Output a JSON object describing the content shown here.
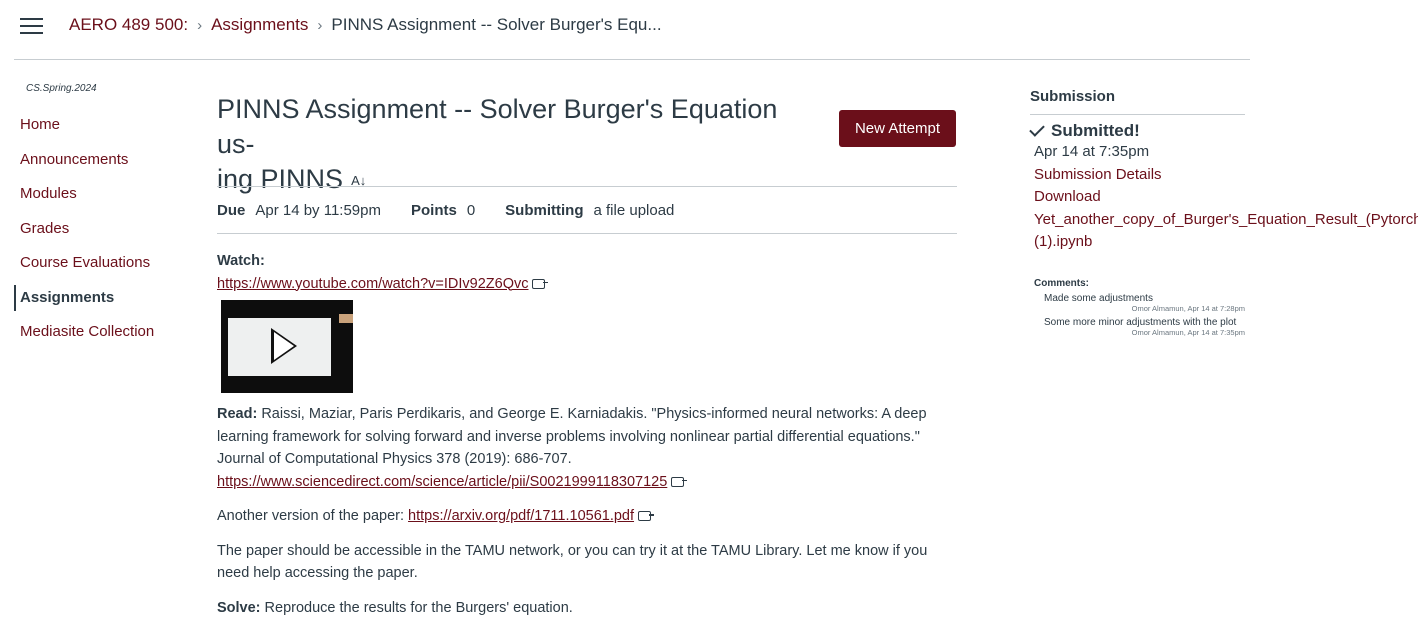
{
  "breadcrumbs": [
    {
      "label": "AERO 489 500:"
    },
    {
      "label": "Assignments"
    },
    {
      "label": "PINNS Assignment -- Solver Burger's Equ..."
    }
  ],
  "sidebar": {
    "term": "CS.Spring.2024",
    "items": [
      {
        "label": "Home"
      },
      {
        "label": "Announcements"
      },
      {
        "label": "Modules"
      },
      {
        "label": "Grades"
      },
      {
        "label": "Course Evaluations"
      },
      {
        "label": "Assignments",
        "active": true
      },
      {
        "label": "Mediasite Collection"
      }
    ]
  },
  "assignment": {
    "title_line1": "PINNS Assignment -- Solver Burger's Equation us-",
    "title_line2": "ing PINNS",
    "title_icon": "A↓",
    "new_attempt_label": "New Attempt",
    "due_label": "Due",
    "due_value": "Apr 14 by 11:59pm",
    "points_label": "Points",
    "points_value": "0",
    "submitting_label": "Submitting",
    "submitting_value": "a file upload",
    "watch_label": "Watch:",
    "watch_link": "https://www.youtube.com/watch?v=IDIv92Z6Qvc",
    "read_label": "Read:",
    "read_text": "Raissi, Maziar, Paris Perdikaris, and George E. Karniadakis. \"Physics-informed neural networks: A deep learning framework for solving forward and inverse problems involving nonlinear partial differential equations.\" Journal of Computational Physics 378 (2019): 686-707.",
    "read_link": "https://www.sciencedirect.com/science/article/pii/S0021999118307125",
    "other_version_text": "Another version of the paper:",
    "other_version_link": "https://arxiv.org/pdf/1711.10561.pdf",
    "access_text": "The paper should be accessible in the TAMU network, or you can try it at the TAMU Library. Let me know if you need help accessing the paper.",
    "solve_label": "Solve:",
    "solve_text": "Reproduce the results for the Burgers' equation."
  },
  "submission": {
    "heading": "Submission",
    "status": "Submitted!",
    "date": "Apr 14 at 7:35pm",
    "details_link": "Submission Details",
    "download_label": "Download",
    "file_line1": "Yet_another_copy_of_Burger's_Equation_Result_(Pytorch)",
    "file_line2": "(1).ipynb",
    "comments_label": "Comments:",
    "comments": [
      {
        "text": "Made some adjustments",
        "meta": "Omor Almamun, Apr 14 at 7:28pm"
      },
      {
        "text": "Some more minor adjustments with the plot",
        "meta": "Omor Almamun, Apr 14 at 7:35pm"
      }
    ]
  },
  "colors": {
    "brand": "#6b0f1a",
    "text": "#2d3b45"
  }
}
